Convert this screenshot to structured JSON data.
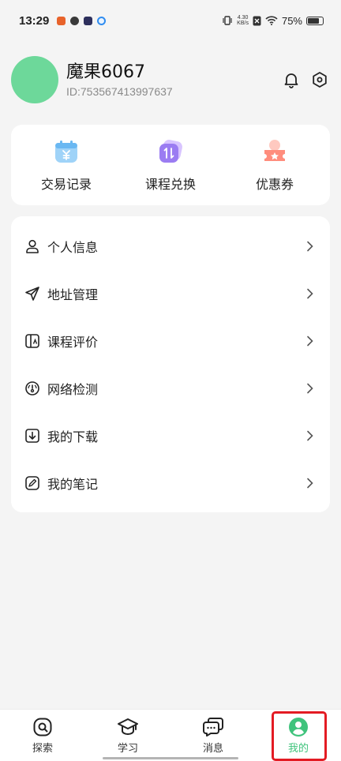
{
  "status_bar": {
    "time": "13:29",
    "net_speed_value": "4.30",
    "net_speed_unit": "KB/s",
    "battery_percent": "75%",
    "battery_level": 0.75
  },
  "profile": {
    "username": "魔果6067",
    "user_id": "ID:753567413997637"
  },
  "quick_actions": [
    {
      "label": "交易记录",
      "icon": "wallet-yuan-icon"
    },
    {
      "label": "课程兑换",
      "icon": "exchange-icon"
    },
    {
      "label": "优惠券",
      "icon": "coupon-icon"
    }
  ],
  "menu": [
    {
      "label": "个人信息",
      "icon": "person-icon"
    },
    {
      "label": "地址管理",
      "icon": "location-arrow-icon"
    },
    {
      "label": "课程评价",
      "icon": "rating-icon"
    },
    {
      "label": "网络检测",
      "icon": "network-check-icon"
    },
    {
      "label": "我的下载",
      "icon": "download-icon"
    },
    {
      "label": "我的笔记",
      "icon": "note-edit-icon"
    }
  ],
  "bottom_nav": [
    {
      "label": "探索",
      "icon": "explore-icon",
      "active": false
    },
    {
      "label": "学习",
      "icon": "graduation-cap-icon",
      "active": false
    },
    {
      "label": "消息",
      "icon": "chat-bubble-icon",
      "active": false
    },
    {
      "label": "我的",
      "icon": "profile-icon",
      "active": true
    }
  ],
  "colors": {
    "accent": "#3fc37c",
    "avatar": "#6dd89a",
    "highlight_box": "#e31b23"
  }
}
